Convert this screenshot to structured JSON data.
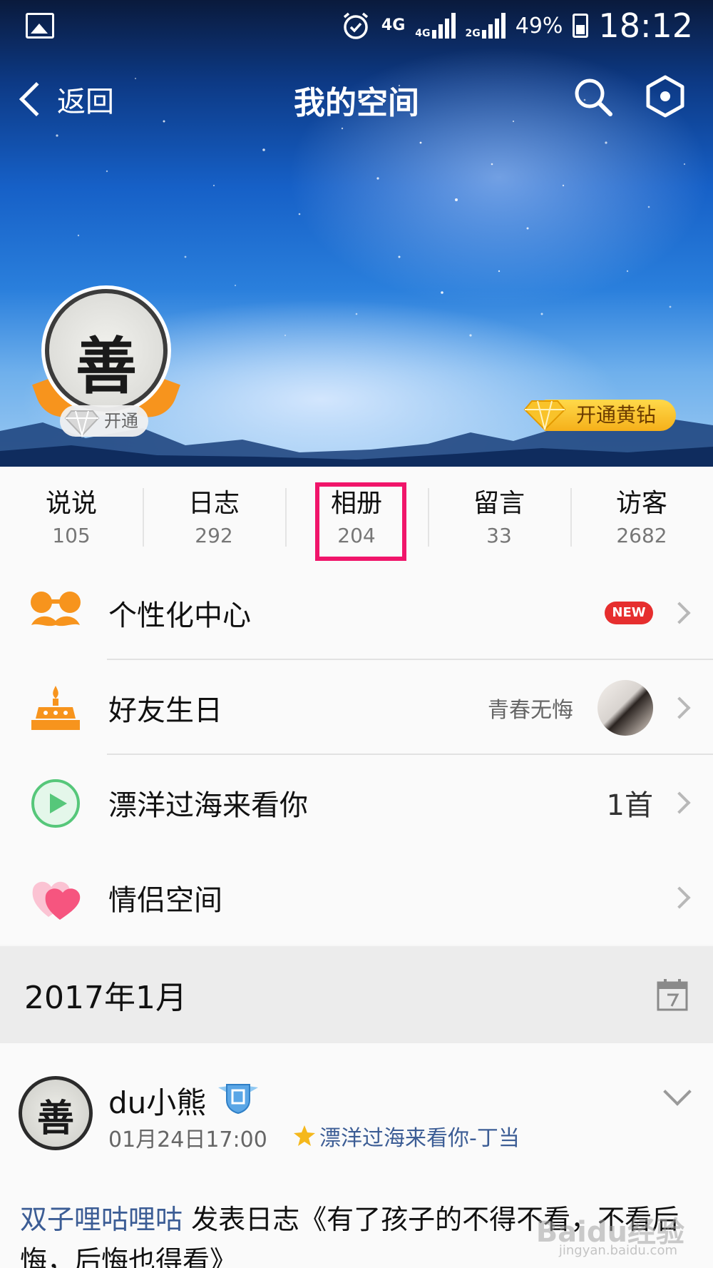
{
  "status_bar": {
    "network_4g": "4G",
    "network_4g_small": "4G",
    "network_2g_small": "2G",
    "battery": "49%",
    "time": "18:12"
  },
  "nav": {
    "back_label": "返回",
    "title": "我的空间"
  },
  "profile": {
    "avatar_char": "善",
    "open_badge": "开通",
    "yellow_diamond": "开通黄钻"
  },
  "stats": [
    {
      "label": "说说",
      "count": "105"
    },
    {
      "label": "日志",
      "count": "292"
    },
    {
      "label": "相册",
      "count": "204"
    },
    {
      "label": "留言",
      "count": "33"
    },
    {
      "label": "访客",
      "count": "2682"
    }
  ],
  "menu": {
    "personalize": {
      "label": "个性化中心",
      "badge": "NEW"
    },
    "birthday": {
      "label": "好友生日",
      "friend": "青春无悔"
    },
    "music": {
      "label": "漂洋过海来看你",
      "count": "1首"
    },
    "couple": {
      "label": "情侣空间"
    }
  },
  "feed": {
    "date": "2017年1月",
    "post": {
      "avatar_char": "善",
      "author": "du小熊",
      "time": "01月24日17:00",
      "music": "漂洋过海来看你-丁当",
      "text_link": "双子哩咕哩咕",
      "text": " 发表日志《有了孩子的不得不看，不看后悔，后悔也得看》"
    },
    "watermark": "Baidu经验",
    "watermark_sub": "jingyan.baidu.com"
  },
  "colors": {
    "highlight": "#f0156a",
    "link": "#3c5d95",
    "new_badge": "#e62e2e",
    "orange_icon": "#f7941d"
  },
  "icons": {
    "status_image": "image-icon",
    "alarm": "alarm-icon",
    "signal": "signal-icon",
    "battery": "battery-icon",
    "back": "chevron-left-icon",
    "search": "search-icon",
    "settings": "hexagon-settings-icon",
    "personalize": "mustache-glasses-icon",
    "birthday": "cake-icon",
    "music": "play-circle-icon",
    "couple": "heart-icon",
    "calendar": "calendar-icon",
    "chevron": "chevron-right-icon",
    "vip": "vip-shield-icon",
    "music_star": "star-icon",
    "more": "chevron-down-icon"
  }
}
